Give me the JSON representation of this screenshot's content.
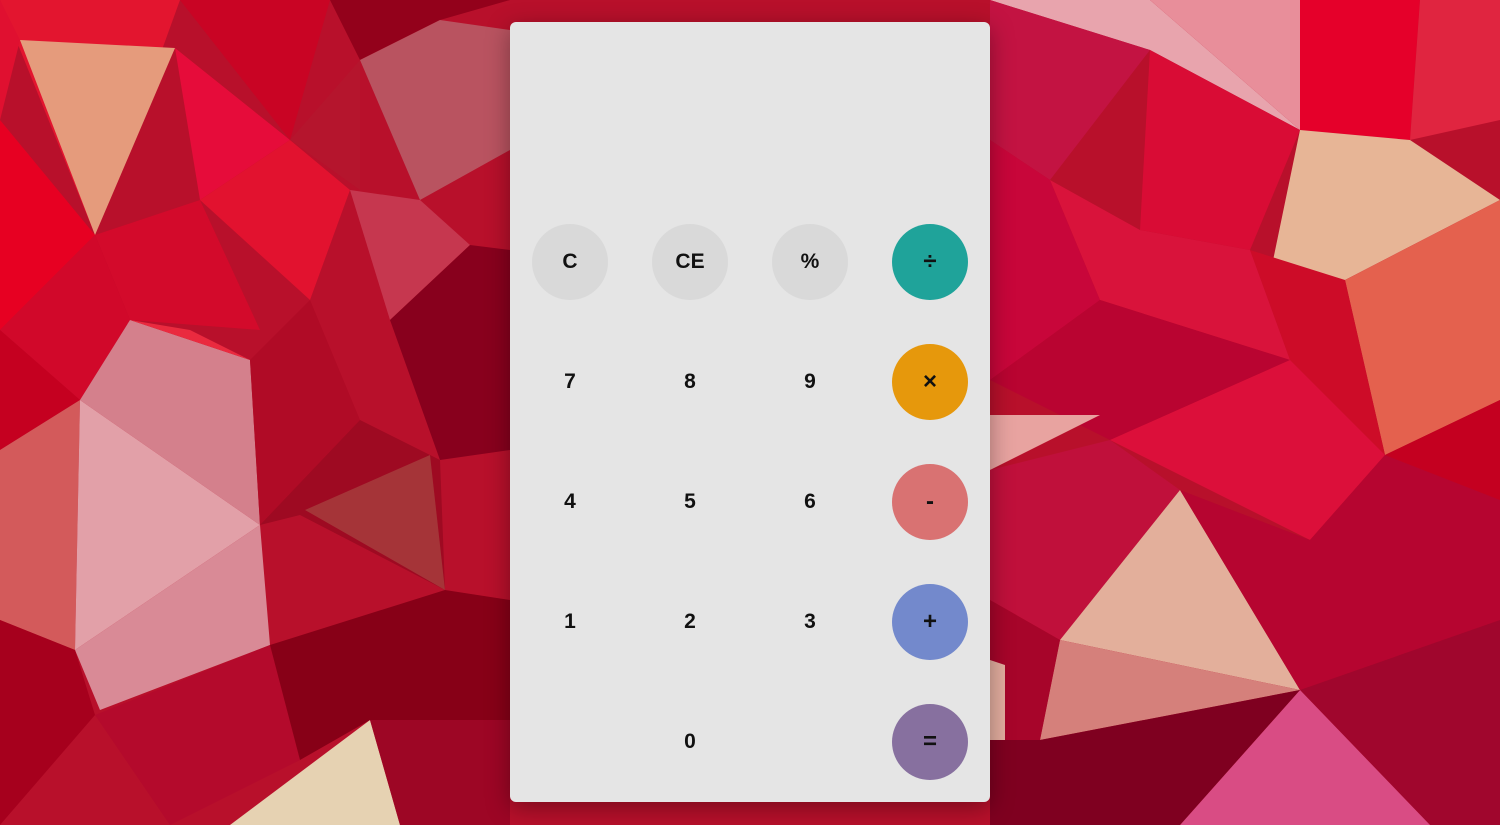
{
  "display": {
    "value": ""
  },
  "keys": {
    "row1": [
      {
        "label": "C",
        "name": "clear-button"
      },
      {
        "label": "CE",
        "name": "clear-entry-button"
      },
      {
        "label": "%",
        "name": "percent-button"
      },
      {
        "label": "÷",
        "name": "divide-button"
      }
    ],
    "row2": [
      {
        "label": "7",
        "name": "digit-7-button"
      },
      {
        "label": "8",
        "name": "digit-8-button"
      },
      {
        "label": "9",
        "name": "digit-9-button"
      },
      {
        "label": "×",
        "name": "multiply-button"
      }
    ],
    "row3": [
      {
        "label": "4",
        "name": "digit-4-button"
      },
      {
        "label": "5",
        "name": "digit-5-button"
      },
      {
        "label": "6",
        "name": "digit-6-button"
      },
      {
        "label": "-",
        "name": "subtract-button"
      }
    ],
    "row4": [
      {
        "label": "1",
        "name": "digit-1-button"
      },
      {
        "label": "2",
        "name": "digit-2-button"
      },
      {
        "label": "3",
        "name": "digit-3-button"
      },
      {
        "label": "+",
        "name": "add-button"
      }
    ],
    "row5": [
      {
        "label": "0",
        "name": "digit-0-button"
      },
      {
        "label": "=",
        "name": "equals-button"
      }
    ]
  },
  "colors": {
    "divide": "#1fa39a",
    "multiply": "#e6980c",
    "subtract": "#d97272",
    "add": "#7389cc",
    "equals": "#87709f",
    "function_key": "#d9d9d9",
    "panel": "#e5e5e5"
  }
}
